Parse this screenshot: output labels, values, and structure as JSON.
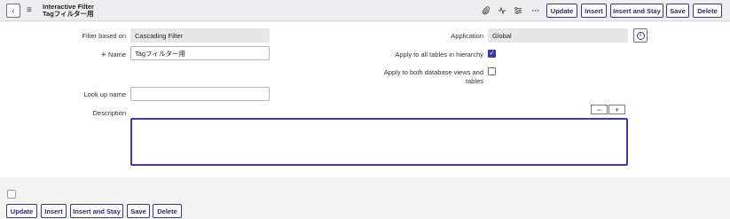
{
  "header": {
    "title": "Interactive Filter",
    "subtitle": "Tagフィルター用",
    "back_icon": "‹",
    "menu_icon": "≡",
    "attach_icon": "📎",
    "activity_icon": "⚡",
    "settings_icon": "☰",
    "more_icon": "···"
  },
  "toolbar": {
    "update": "Update",
    "insert": "Insert",
    "insert_and_stay": "Insert and Stay",
    "save": "Save",
    "delete": "Delete"
  },
  "form": {
    "filter_based_on_label": "Filter based on",
    "filter_based_on_value": "Cascading Filter",
    "name_label": "Name",
    "name_required_mark": "✳",
    "name_value": "Tagフィルター用",
    "lookup_label": "Look up name",
    "lookup_value": "",
    "description_label": "Description",
    "application_label": "Application",
    "application_value": "Global",
    "apply_hierarchy_label": "Apply to all tables in hierarchy",
    "apply_hierarchy_checked": true,
    "apply_db_views_label_line1": "Apply to both database views and",
    "apply_db_views_label_line2": "tables",
    "apply_db_views_checked": false,
    "info_icon": "i",
    "minus_icon": "−",
    "plus_icon": "+"
  },
  "footer": {
    "update": "Update",
    "insert": "Insert",
    "insert_and_stay": "Insert and Stay",
    "save": "Save",
    "delete": "Delete"
  },
  "colors": {
    "accent": "#3b3bb0",
    "button_border": "#3a3a7a",
    "header_bg": "#eeeef0"
  }
}
